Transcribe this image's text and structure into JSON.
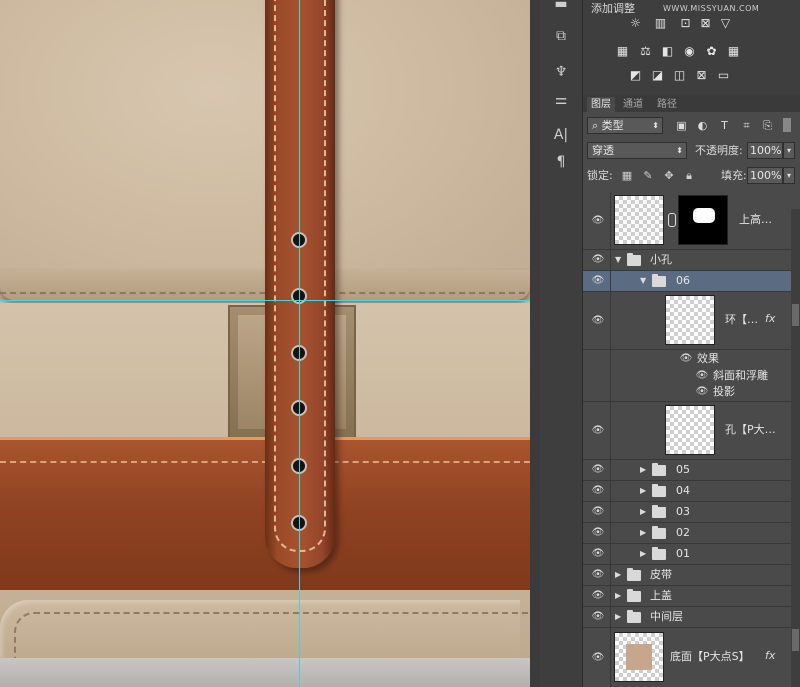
{
  "adjustments": {
    "title": "添加调整"
  },
  "tabs": [
    "图层",
    "通道",
    "路径"
  ],
  "filter": {
    "kind_label": "类型"
  },
  "blend": {
    "mode": "穿透",
    "opacity_label": "不透明度:",
    "opacity_value": "100%"
  },
  "lock": {
    "label": "锁定:",
    "fill_label": "填充:",
    "fill_value": "100%"
  },
  "layers": {
    "top_layer": "上高…",
    "group_small_holes": "小孔",
    "group_06": "06",
    "layer_ring": "环【…",
    "effects_label": "效果",
    "effect_bevel": "斜面和浮雕",
    "effect_shadow": "投影",
    "layer_hole": "孔【P大…",
    "group_05": "05",
    "group_04": "04",
    "group_03": "03",
    "group_02": "02",
    "group_01": "01",
    "group_belt": "皮带",
    "group_lid": "上盖",
    "group_middle": "中间层",
    "layer_base": "底面【P大点S】",
    "fx": "fx"
  },
  "watermark": "WWW.MISSYUAN.COM",
  "colors": {
    "selected_row": "#5b6c82",
    "guide": "#3fd6e0",
    "strap": "#9a4a28",
    "canvas_felt": "#cdbca4"
  }
}
